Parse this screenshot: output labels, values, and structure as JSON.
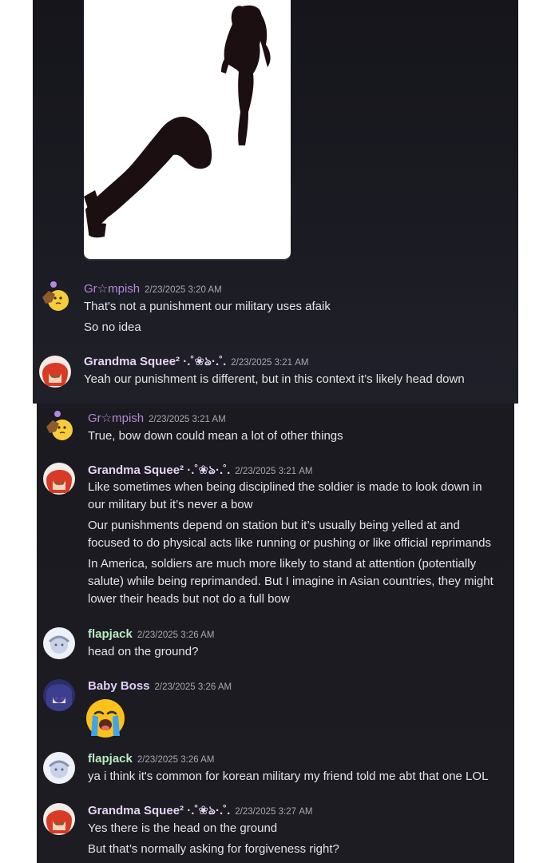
{
  "users": {
    "grumpish": {
      "name": "Gr☆mpish",
      "color": "#b389d6"
    },
    "squee": {
      "name": "Grandma Squee² ·.˚❀ঌ·.˚.",
      "color": "#e6d4f2"
    },
    "flapjack": {
      "name": "flapjack",
      "color": "#b8ecc4"
    },
    "baby": {
      "name": "Baby Boss",
      "color": "#e0cdf6"
    }
  },
  "messages": [
    {
      "user": "Gr☆mpish",
      "timestamp": "2/23/2025 3:20 AM",
      "lines": [
        "That's not a punishment our military uses afaik",
        "So no idea"
      ]
    },
    {
      "user": "Grandma Squee² ·.˚❀ঌ·.˚.",
      "timestamp": "2/23/2025 3:21 AM",
      "lines": [
        "Yeah our punishment is different, but in this context it’s likely head down"
      ]
    },
    {
      "user": "Gr☆mpish",
      "timestamp": "2/23/2025 3:21 AM",
      "lines": [
        "True, bow down could mean a lot of other things"
      ]
    },
    {
      "user": "Grandma Squee² ·.˚❀ঌ·.˚.",
      "timestamp": "2/23/2025 3:21 AM",
      "lines": [
        "Like sometimes when being disciplined the soldier is made to look down in our military but it’s never a bow",
        "Our punishments depend on station but it’s usually being yelled at and focused to do physical acts like running or pushing or like official reprimands",
        "In America, soldiers are much more likely to stand at attention (potentially salute) while being reprimanded. But I imagine in Asian countries, they might lower their heads but not do a full bow"
      ]
    },
    {
      "user": "flapjack",
      "timestamp": "2/23/2025 3:26 AM",
      "lines": [
        "head on the ground?"
      ]
    },
    {
      "user": "Baby Boss",
      "timestamp": "2/23/2025 3:26 AM",
      "emoji": "loudly-crying-face"
    },
    {
      "user": "flapjack",
      "timestamp": "2/23/2025 3:26 AM",
      "lines": [
        "ya i think it's common for korean military my friend told me abt that one LOL"
      ]
    },
    {
      "user": "Grandma Squee² ·.˚❀ঌ·.˚.",
      "timestamp": "2/23/2025 3:27 AM",
      "lines": [
        "Yes there is the head on the ground",
        "But that’s normally asking for forgiveness right?"
      ]
    }
  ],
  "attachment": {
    "icon": "image-attachment",
    "subject": "two-silhouettes-bowing-and-standing"
  },
  "colors": {
    "background": "#1b1c23",
    "text": "#e3e4e8",
    "timestamp": "#a6a8b4"
  }
}
